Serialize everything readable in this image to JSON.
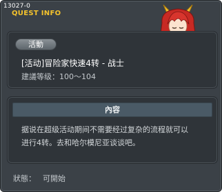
{
  "window": {
    "quest_id": "13027-0",
    "title": "QUEST INFO"
  },
  "quest": {
    "category_badge": "活動",
    "name": "[活动]冒险家快速4转 - 战士",
    "level_requirement": "建議等级：100～104"
  },
  "content": {
    "header": "內容",
    "line1": "据说在超级活动期间不需要经过复杂的流程就可以",
    "line2": "进行4转。去和哈尔模尼亚谈谈吧。"
  },
  "status": {
    "label": "狀態：",
    "value": "可開始"
  },
  "colors": {
    "window_bg": "#3b4147",
    "panel_bg": "#2f3439",
    "title_gold": "#f5c32c",
    "content_header_bg": "#4a5a66",
    "character_hair": "#d0342c",
    "character_horns": "#f2c130"
  },
  "npc": {
    "icon": "red-haired-npc-portrait"
  }
}
